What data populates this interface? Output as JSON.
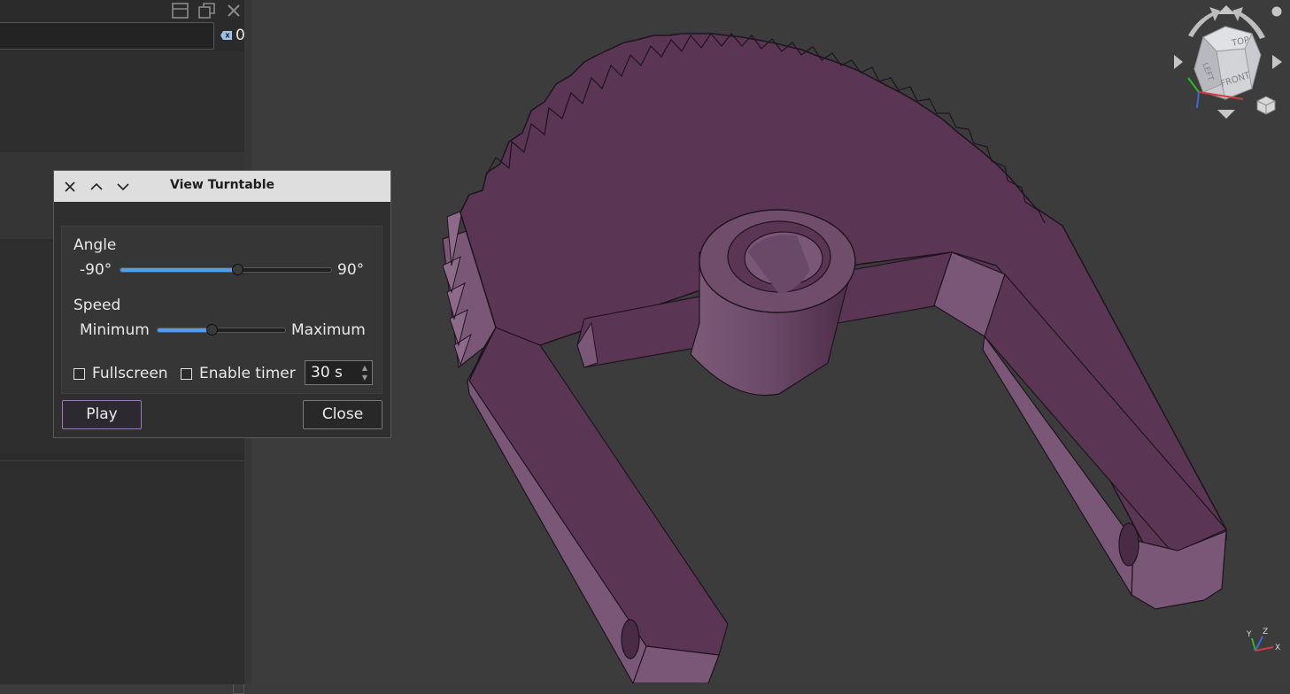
{
  "left_panel": {
    "filter_count": "0"
  },
  "dialog": {
    "title": "View Turntable",
    "angle": {
      "label": "Angle",
      "min_label": "-90°",
      "max_label": "90°",
      "value_fraction": 0.56
    },
    "speed": {
      "label": "Speed",
      "min_label": "Minimum",
      "max_label": "Maximum",
      "value_fraction": 0.43
    },
    "fullscreen_label": "Fullscreen",
    "enable_timer_label": "Enable timer",
    "timer_value": "30 s",
    "play_label": "Play",
    "close_label": "Close"
  },
  "navcube": {
    "faces": [
      "TOP",
      "LEFT",
      "FRONT"
    ]
  },
  "axis_indicator": {
    "labels": [
      "Y",
      "Z",
      "X"
    ]
  },
  "colors": {
    "model_face": "#5a3654",
    "model_side": "#7a5776",
    "viewport_bg": "#3c3c3c",
    "slider_fill": "#4f9ef0",
    "play_border": "#9c7ab7"
  }
}
